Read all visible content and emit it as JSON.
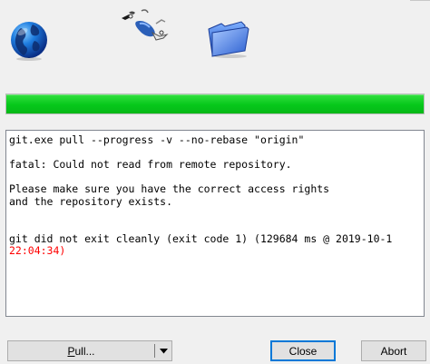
{
  "icons": {
    "globe": "globe-icon",
    "sync": "sync-icon",
    "folder": "folder-icon"
  },
  "progress": {
    "value_percent": 100,
    "color": "#06c81a"
  },
  "log": {
    "lines": [
      {
        "text": "git.exe pull --progress -v --no-rebase \"origin\"",
        "color": "#000000"
      },
      {
        "text": "",
        "color": "#000000"
      },
      {
        "text": "fatal: Could not read from remote repository.",
        "color": "#000000"
      },
      {
        "text": "",
        "color": "#000000"
      },
      {
        "text": "Please make sure you have the correct access rights",
        "color": "#000000"
      },
      {
        "text": "and the repository exists.",
        "color": "#000000"
      },
      {
        "text": "",
        "color": "#000000"
      },
      {
        "text": "",
        "color": "#000000"
      },
      {
        "text": "git did not exit cleanly (exit code 1) (129684 ms @ 2019-10-1",
        "color": "#000000"
      },
      {
        "text": "22:04:34)",
        "color": "#ff0000"
      }
    ]
  },
  "buttons": {
    "pull_label_first": "P",
    "pull_label_rest": "ull...",
    "close_label": "Close",
    "abort_label": "Abort"
  },
  "colors": {
    "error": "#ff0000",
    "focus": "#0078d7"
  }
}
